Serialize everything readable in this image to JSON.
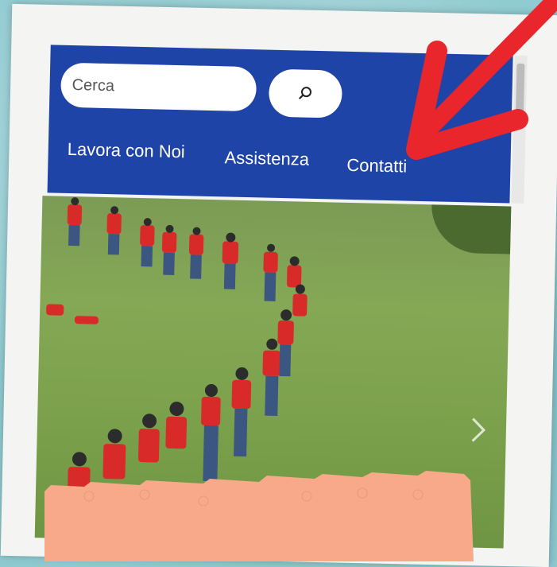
{
  "search": {
    "placeholder": "Cerca",
    "button_icon": "search-icon"
  },
  "nav": {
    "items": [
      {
        "label": "Lavora con Noi"
      },
      {
        "label": "Assistenza"
      },
      {
        "label": "Contatti"
      }
    ]
  },
  "slider": {
    "next_icon": "chevron-right-icon"
  },
  "colors": {
    "header": "#1f44a8",
    "arrow": "#e8262b",
    "torn_paper": "#f7a98a",
    "background": "#90cbd1"
  }
}
